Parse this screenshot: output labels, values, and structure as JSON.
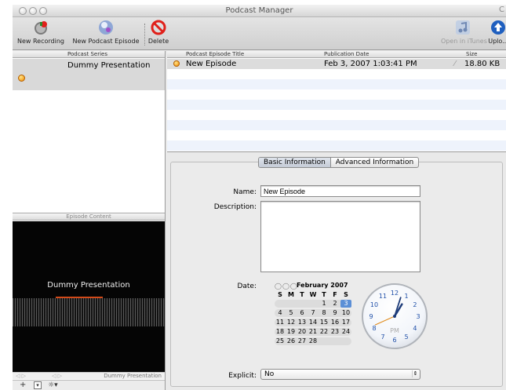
{
  "window": {
    "title": "Podcast Manager",
    "title_right": "C"
  },
  "toolbar": {
    "new_recording": "New Recording",
    "new_episode": "New Podcast Episode",
    "delete": "Delete",
    "open_itunes": "Open in iTunes",
    "upload": "Uplo..."
  },
  "series": {
    "header": "Podcast Series",
    "items": [
      {
        "label": "Dummy Presentation"
      }
    ]
  },
  "episode_content": {
    "header": "Episode Content",
    "preview_title": "Dummy Presentation",
    "scrubber_label": "Dummy Presentation",
    "add": "+",
    "action": "☼▾"
  },
  "episodes": {
    "headers": {
      "title": "Podcast Episode Title",
      "date": "Publication Date",
      "size": "Size"
    },
    "rows": [
      {
        "title": "New Episode",
        "date": "Feb 3, 2007 1:03:41 PM",
        "size": "18.80 KB"
      }
    ]
  },
  "tabs": {
    "basic": "Basic Information",
    "advanced": "Advanced Information"
  },
  "form": {
    "name_label": "Name:",
    "name_value": "New Episode",
    "description_label": "Description:",
    "description_value": "",
    "date_label": "Date:",
    "explicit_label": "Explicit:",
    "explicit_value": "No"
  },
  "calendar": {
    "month": "February 2007",
    "dow": [
      "S",
      "M",
      "T",
      "W",
      "T",
      "F",
      "S"
    ],
    "weeks": [
      [
        "",
        "",
        "",
        "",
        "1",
        "2",
        "3"
      ],
      [
        "4",
        "5",
        "6",
        "7",
        "8",
        "9",
        "10"
      ],
      [
        "11",
        "12",
        "13",
        "14",
        "15",
        "16",
        "17"
      ],
      [
        "18",
        "19",
        "20",
        "21",
        "22",
        "23",
        "24"
      ],
      [
        "25",
        "26",
        "27",
        "28",
        "",
        "",
        ""
      ]
    ],
    "selected": "3"
  },
  "clock": {
    "numbers": [
      "12",
      "1",
      "2",
      "3",
      "4",
      "5",
      "6",
      "7",
      "8",
      "9",
      "10",
      "11"
    ],
    "ampm": "PM",
    "hour": 1,
    "minute": 3,
    "second": 41
  },
  "colors": {
    "selection": "#5b8fd6",
    "feed": "#f28b00",
    "delete": "#e0201a"
  }
}
